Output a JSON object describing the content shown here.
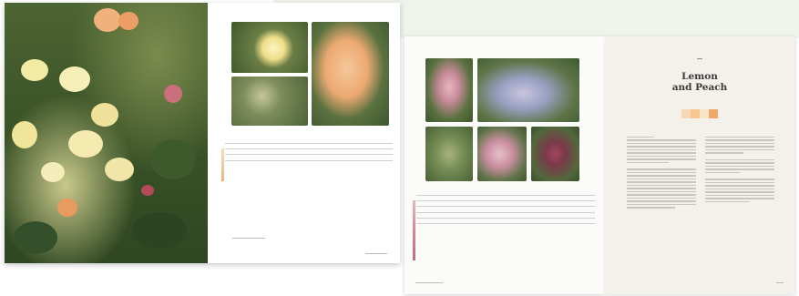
{
  "spread_right": {
    "chapter_title_line1": "Lemon",
    "chapter_title_line2": "and Peach",
    "swatches": [
      "#f6d9b4",
      "#f8c690",
      "#f5e6c6",
      "#f0a869"
    ]
  },
  "colors": {
    "background": "#ffffff",
    "mint_band": "#eef3ec",
    "page": "#ffffff",
    "cream_page": "#f4f1ea",
    "foliage_dark": "#2f4a26",
    "flower_yellow": "#f3eaa4",
    "flower_peach": "#f0b27a",
    "table_stripe_peach": "#f3c9a0",
    "table_stripe_pink": "#d9849c"
  }
}
